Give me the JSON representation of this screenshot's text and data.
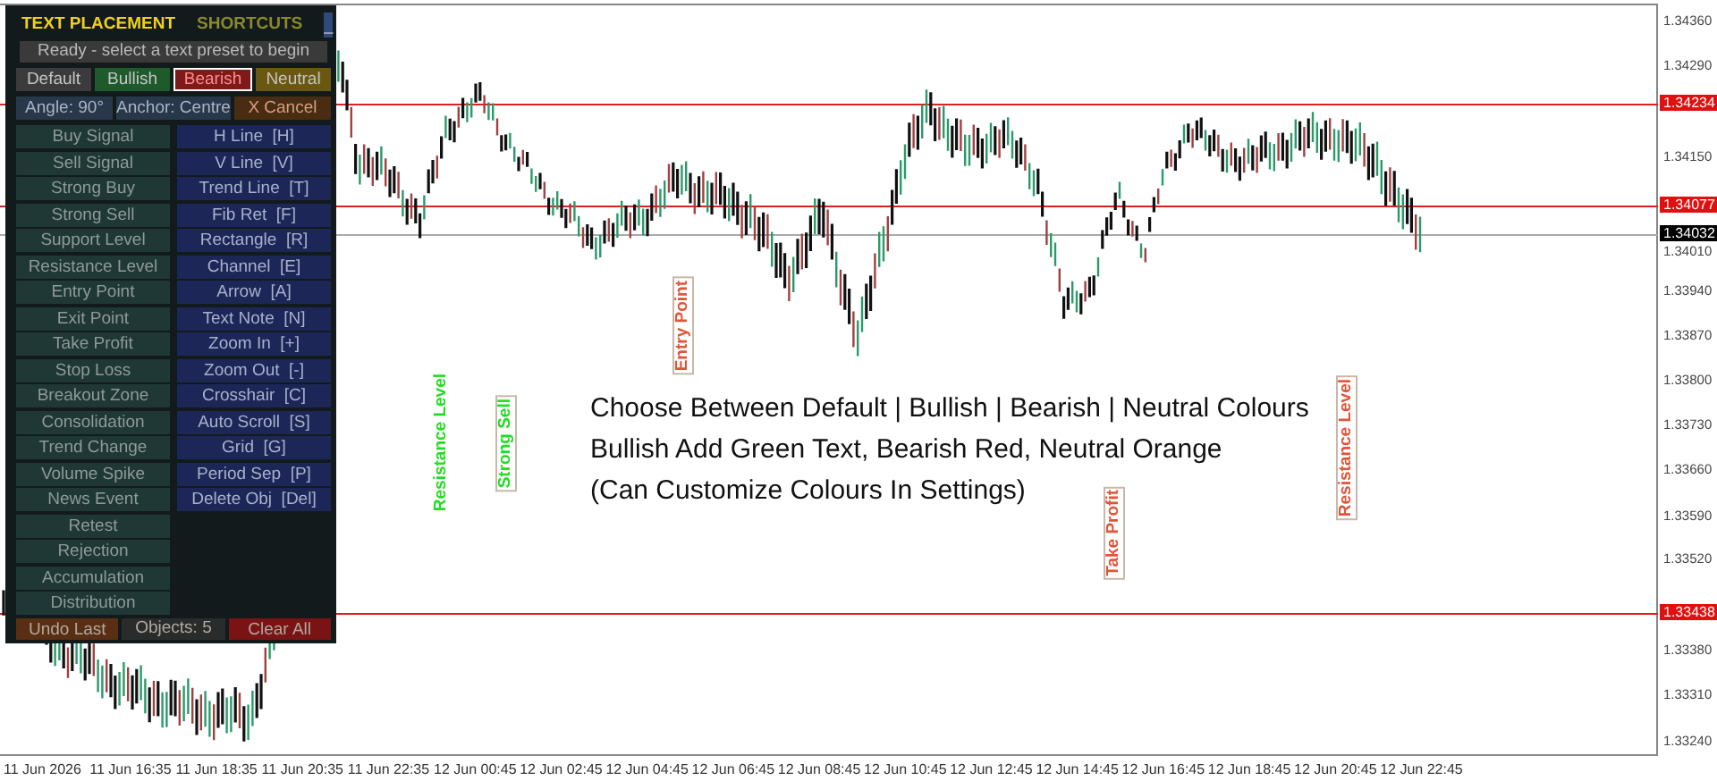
{
  "panel": {
    "header": [
      {
        "label": "TEXT PLACEMENT",
        "selected": true
      },
      {
        "label": "SHORTCUTS",
        "selected": false
      }
    ],
    "minimize": "_",
    "status": "Ready - select a text preset to begin",
    "presets": [
      {
        "label": "Default",
        "selected": false,
        "color": "#3b3b3b"
      },
      {
        "label": "Bullish",
        "selected": false,
        "color": "#1e5a2c"
      },
      {
        "label": "Bearish",
        "selected": true,
        "color": "#7d1a1a"
      },
      {
        "label": "Neutral",
        "selected": false,
        "color": "#6b5810"
      }
    ],
    "options": [
      {
        "label": "Angle: 90°",
        "kind": "setting"
      },
      {
        "label": "Anchor: Centre",
        "kind": "setting"
      },
      {
        "label": "X Cancel",
        "kind": "cancel"
      }
    ],
    "text_presets": [
      "Buy Signal",
      "Sell Signal",
      "Strong Buy",
      "Strong Sell",
      "Support Level",
      "Resistance Level",
      "Entry Point",
      "Exit Point",
      "Take Profit",
      "Stop Loss",
      "Breakout Zone",
      "Consolidation",
      "Trend Change",
      "Volume Spike",
      "News Event",
      "Retest",
      "Rejection",
      "Accumulation",
      "Distribution"
    ],
    "shortcuts": [
      "H Line  [H]",
      "V Line  [V]",
      "Trend Line  [T]",
      "Fib Ret  [F]",
      "Rectangle  [R]",
      "Channel  [E]",
      "Arrow  [A]",
      "Text Note  [N]",
      "Zoom In  [+]",
      "Zoom Out  [-]",
      "Crosshair  [C]",
      "Auto Scroll  [S]",
      "Grid  [G]",
      "Period Sep  [P]",
      "Delete Obj  [Del]"
    ],
    "footer": [
      {
        "label": "Undo Last",
        "kind": "undo"
      },
      {
        "label": "Objects: 5",
        "kind": "count"
      },
      {
        "label": "Clear All",
        "kind": "clear"
      }
    ]
  },
  "chart": {
    "price_ticks": [
      "1.34360",
      "1.34290",
      "1.34150",
      "1.34010",
      "1.33940",
      "1.33870",
      "1.33800",
      "1.33730",
      "1.33660",
      "1.33590",
      "1.33520",
      "1.33380",
      "1.33310",
      "1.33240"
    ],
    "levels": [
      {
        "label": "1.34234",
        "kind": "alert"
      },
      {
        "label": "1.34077",
        "kind": "alert"
      },
      {
        "label": "1.34032",
        "kind": "current"
      },
      {
        "label": "1.33438",
        "kind": "alert"
      }
    ],
    "time_labels": [
      "11 Jun 2026",
      "11 Jun 16:35",
      "11 Jun 18:35",
      "11 Jun 20:35",
      "11 Jun 22:35",
      "12 Jun 00:45",
      "12 Jun 02:45",
      "12 Jun 04:45",
      "12 Jun 06:45",
      "12 Jun 08:45",
      "12 Jun 10:45",
      "12 Jun 12:45",
      "12 Jun 14:45",
      "12 Jun 16:45",
      "12 Jun 18:45",
      "12 Jun 20:45",
      "12 Jun 22:45"
    ],
    "annotations": [
      {
        "text": "Entry Point",
        "color": "#e0553a",
        "framed": true
      },
      {
        "text": "Resistance Level",
        "color": "#22dd22",
        "framed": false
      },
      {
        "text": "Strong Sell",
        "color": "#22dd22",
        "framed": true
      },
      {
        "text": "Take Profit",
        "color": "#e0553a",
        "framed": true
      },
      {
        "text": "Resistance Level",
        "color": "#e0553a",
        "framed": true
      }
    ],
    "note": [
      "Choose Between Default | Bullish | Bearish | Neutral Colours",
      "Bullish Add Green Text, Bearish Red, Neutral Orange",
      "(Can Customize Colours In Settings)"
    ]
  }
}
